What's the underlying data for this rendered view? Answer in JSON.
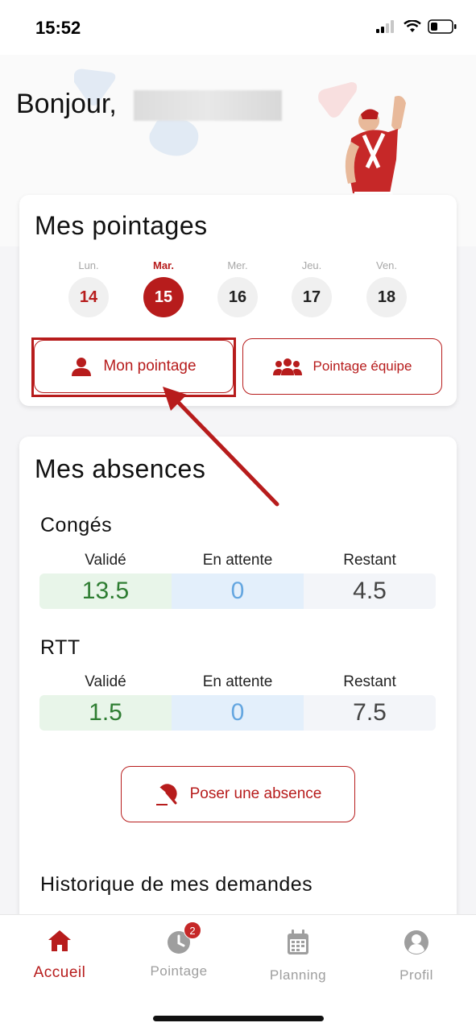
{
  "status_bar": {
    "time": "15:52"
  },
  "hero": {
    "greeting": "Bonjour,"
  },
  "pointages": {
    "title": "Mes pointages",
    "days": [
      {
        "label": "Lun.",
        "num": "14",
        "state": "past"
      },
      {
        "label": "Mar.",
        "num": "15",
        "state": "today"
      },
      {
        "label": "Mer.",
        "num": "16",
        "state": "future"
      },
      {
        "label": "Jeu.",
        "num": "17",
        "state": "future"
      },
      {
        "label": "Ven.",
        "num": "18",
        "state": "future"
      }
    ],
    "mon_pointage_label": "Mon pointage",
    "pointage_equipe_label": "Pointage équipe"
  },
  "absences": {
    "title": "Mes absences",
    "columns": [
      "Validé",
      "En attente",
      "Restant"
    ],
    "conges": {
      "title": "Congés",
      "valide": "13.5",
      "en_attente": "0",
      "restant": "4.5"
    },
    "rtt": {
      "title": "RTT",
      "valide": "1.5",
      "en_attente": "0",
      "restant": "7.5"
    },
    "poser_label": "Poser une absence",
    "historique_title": "Historique de mes demandes"
  },
  "nav": {
    "items": [
      {
        "label": "Accueil",
        "icon": "home-icon",
        "active": true
      },
      {
        "label": "Pointage",
        "icon": "clock-icon",
        "badge": "2"
      },
      {
        "label": "Planning",
        "icon": "calendar-icon"
      },
      {
        "label": "Profil",
        "icon": "user-icon"
      }
    ]
  },
  "colors": {
    "accent": "#b71c1c",
    "valide_bg": "#e8f5e9",
    "valide_fg": "#2e7d32",
    "attente_bg": "#e3effb",
    "attente_fg": "#64a6e0",
    "restant_bg": "#f3f5f9",
    "restant_fg": "#444444"
  }
}
